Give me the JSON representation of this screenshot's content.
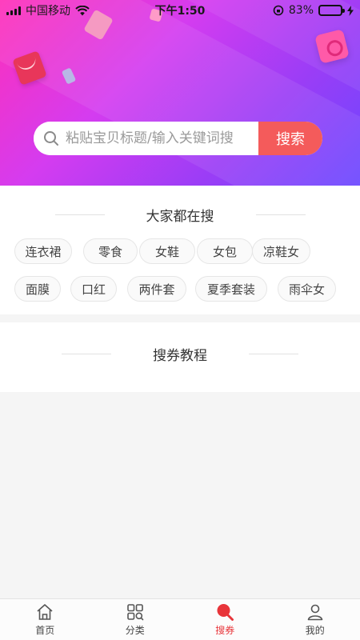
{
  "status_bar": {
    "carrier": "中国移动",
    "time": "下午1:50",
    "battery": "83%",
    "battery_level": 0.83
  },
  "search": {
    "placeholder": "粘贴宝贝标题/输入关键词搜",
    "button_label": "搜索"
  },
  "hot_searches": {
    "title": "大家都在搜",
    "tags": [
      "连衣裙",
      "零食",
      "女鞋",
      "女包",
      "凉鞋女",
      "面膜",
      "口红",
      "两件套",
      "夏季套装",
      "雨伞女"
    ]
  },
  "tutorial": {
    "title": "搜券教程"
  },
  "tabbar": {
    "items": [
      {
        "label": "首页",
        "icon": "home-icon"
      },
      {
        "label": "分类",
        "icon": "category-grid-icon"
      },
      {
        "label": "搜券",
        "icon": "search-coupon-icon",
        "active": true
      },
      {
        "label": "我的",
        "icon": "user-icon"
      }
    ]
  },
  "colors": {
    "accent": "#f45b5b",
    "active_tab": "#e8353a",
    "hero_gradient": [
      "#ff2fb8",
      "#d43cf0",
      "#9b3df6",
      "#6a47ff"
    ]
  }
}
